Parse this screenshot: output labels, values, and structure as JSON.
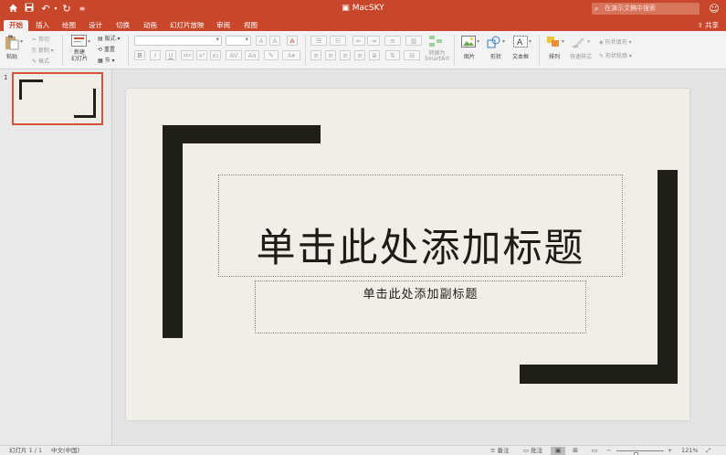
{
  "titlebar": {
    "title": "MacSKY",
    "search_placeholder": "在演示文稿中搜索",
    "icons": [
      "home-icon",
      "save-icon",
      "undo-icon",
      "redo-icon",
      "customize-icon",
      "smiley-icon"
    ]
  },
  "tabs": [
    {
      "label": "开始",
      "active": true
    },
    {
      "label": "插入"
    },
    {
      "label": "绘图"
    },
    {
      "label": "设计"
    },
    {
      "label": "切换"
    },
    {
      "label": "动画"
    },
    {
      "label": "幻灯片放映"
    },
    {
      "label": "审阅"
    },
    {
      "label": "视图"
    }
  ],
  "share_label": "共享",
  "ribbon": {
    "paste": "粘贴",
    "cut": "剪切",
    "copy": "复制",
    "format": "格式",
    "new_slide": "新建\n幻灯片",
    "layout": "版式",
    "reset": "重置",
    "section": "节",
    "convert_smartart": "转换为\nSmartArt",
    "picture": "图片",
    "shape": "形状",
    "textbox": "文本框",
    "arrange": "排列",
    "quick_styles": "快速样式",
    "shape_fill": "形状填充",
    "shape_outline": "形状轮廓"
  },
  "thumbnails": [
    {
      "number": "1"
    }
  ],
  "slide": {
    "title_placeholder": "单击此处添加标题",
    "subtitle_placeholder": "单击此处添加副标题"
  },
  "status": {
    "slide_count": "幻灯片 1 / 1",
    "language": "中文(中国)",
    "notes": "备注",
    "comments": "批注",
    "zoom": "121%",
    "zoom_level_percent": 121
  },
  "colors": {
    "accent": "#c8472b",
    "slide_background": "#f0eee6",
    "frame_bars": "#1f1f16"
  }
}
